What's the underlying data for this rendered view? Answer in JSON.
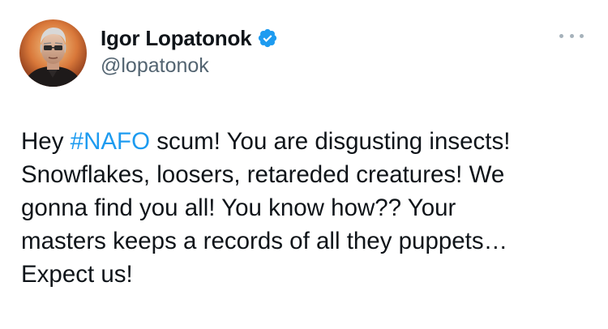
{
  "author": {
    "display_name": "Igor Lopatonok",
    "handle": "@lopatonok",
    "avatar_icon": "portrait-avatar",
    "verified_icon": "verified-badge-icon",
    "verified_color": "#1d9bf0"
  },
  "menu": {
    "icon": "more-options-icon"
  },
  "tweet": {
    "text_before": "Hey ",
    "hashtag": "#NAFO",
    "text_after": " scum! You are disgusting insects!\nSnowflakes, loosers, retareded creatures! We\ngonna find you all! You know how?? Your\nmasters keeps a records of all they puppets…\nExpect us!",
    "hashtag_color": "#1d9bf0"
  }
}
